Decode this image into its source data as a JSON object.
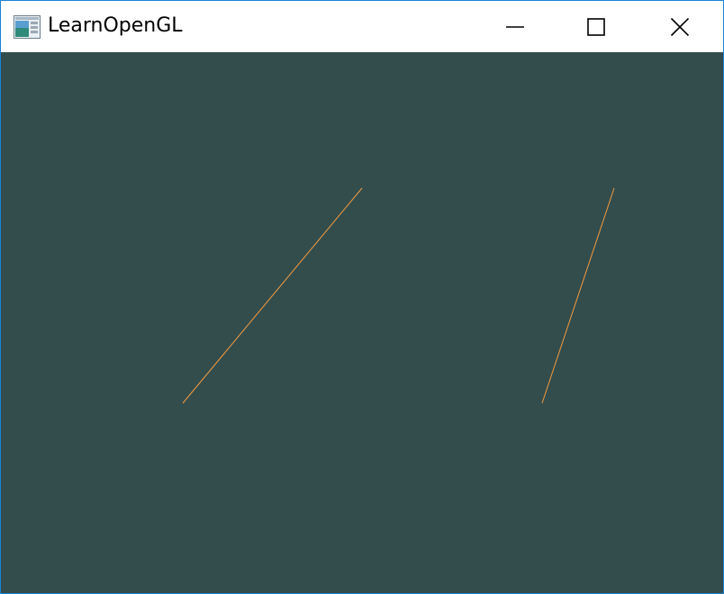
{
  "window": {
    "title": "LearnOpenGL",
    "accent_color": "#1883d7",
    "clear_color": "#334d4d",
    "line_color": "#f49a3e"
  },
  "titlebar": {
    "app_icon": "opengl-window-icon",
    "buttons": [
      {
        "name": "minimize",
        "icon": "minimize-icon"
      },
      {
        "name": "maximize",
        "icon": "maximize-icon"
      },
      {
        "name": "close",
        "icon": "close-icon"
      }
    ]
  },
  "scene": {
    "primitive": "lines",
    "line_count": 2
  }
}
